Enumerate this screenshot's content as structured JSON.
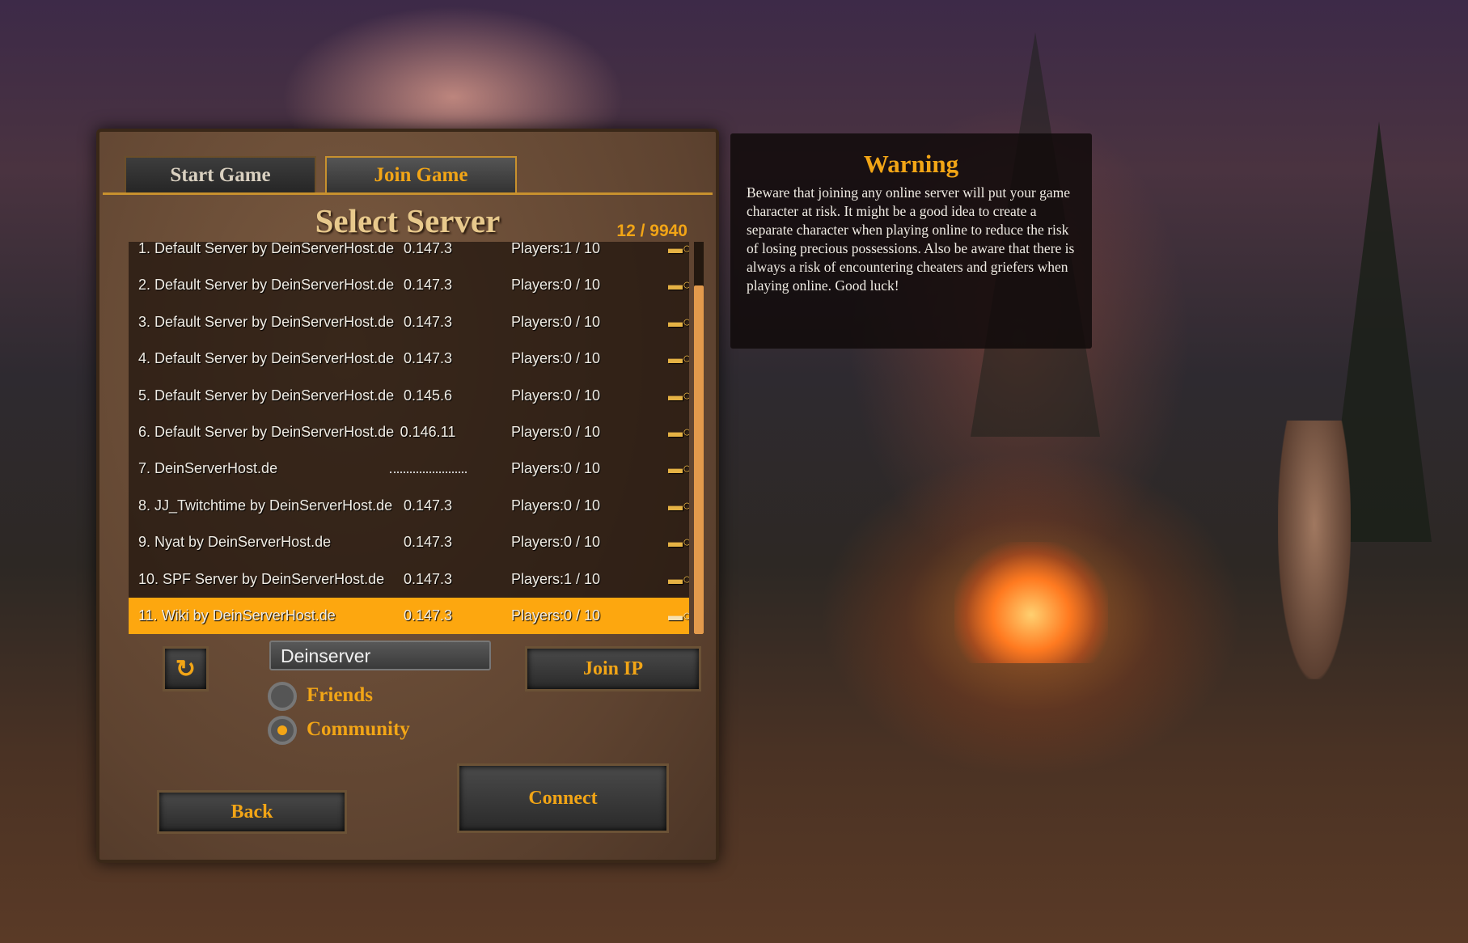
{
  "tabs": {
    "start_game": "Start Game",
    "join_game": "Join Game"
  },
  "title": "Select Server",
  "counter": "12 / 9940",
  "servers": [
    {
      "name": "1. Default Server by DeinServerHost.de",
      "version": "0.147.3",
      "players": "Players:1 / 10"
    },
    {
      "name": "2. Default Server by DeinServerHost.de",
      "version": "0.147.3",
      "players": "Players:0 / 10"
    },
    {
      "name": "3. Default Server by DeinServerHost.de",
      "version": "0.147.3",
      "players": "Players:0 / 10"
    },
    {
      "name": "4. Default Server by DeinServerHost.de",
      "version": "0.147.3",
      "players": "Players:0 / 10"
    },
    {
      "name": "5. Default Server by DeinServerHost.de",
      "version": "0.145.6",
      "players": "Players:0 / 10"
    },
    {
      "name": "6. Default Server by DeinServerHost.de",
      "version": "0.146.11",
      "players": "Players:0 / 10"
    },
    {
      "name": "7. DeinServerHost.de",
      "version": "",
      "players": "Players:0 / 10"
    },
    {
      "name": "8. JJ_Twitchtime by DeinServerHost.de",
      "version": "0.147.3",
      "players": "Players:0 / 10"
    },
    {
      "name": "9. Nyat by DeinServerHost.de",
      "version": "0.147.3",
      "players": "Players:0 / 10"
    },
    {
      "name": "10. SPF Server by DeinServerHost.de",
      "version": "0.147.3",
      "players": "Players:1 / 10"
    },
    {
      "name": "11. Wiki by DeinServerHost.de",
      "version": "0.147.3",
      "players": "Players:0 / 10",
      "selected": true
    }
  ],
  "key_icon": "key-icon",
  "search": {
    "value": "Deinserver"
  },
  "filters": {
    "friends": "Friends",
    "community": "Community",
    "selected": "community"
  },
  "buttons": {
    "join_ip": "Join IP",
    "back": "Back",
    "connect": "Connect",
    "refresh_icon": "refresh-icon"
  },
  "warning": {
    "title": "Warning",
    "body": "Beware that joining any online server will put your game character at risk. It might be a good idea to create a separate character when playing online to reduce the risk of losing precious possessions. Also be aware that there is always a risk of encountering cheaters and griefers when playing online. Good luck!"
  },
  "colors": {
    "accent": "#f2a516",
    "selected_row": "#fda70f",
    "scrollbar": "#e39a4c"
  }
}
